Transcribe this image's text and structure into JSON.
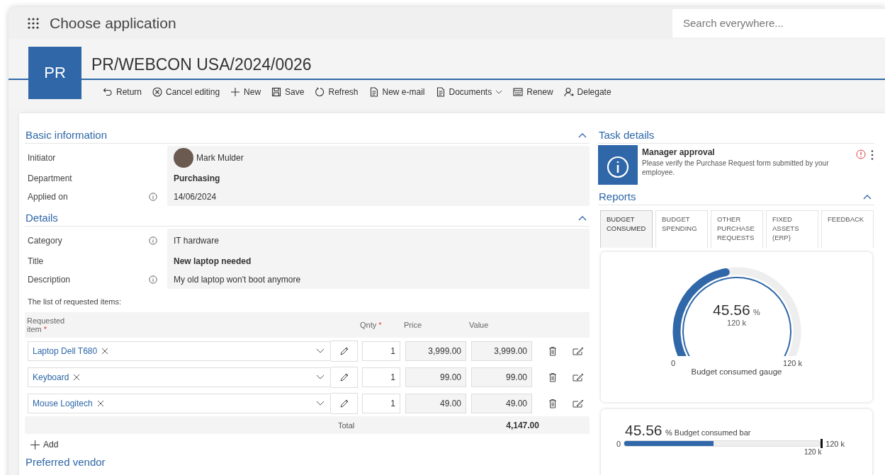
{
  "app_bar": {
    "title": "Choose application",
    "search": {
      "placeholder": "Search everywhere..."
    }
  },
  "document": {
    "tile": "PR",
    "title": "PR/WEBCON USA/2024/0026"
  },
  "toolbar": [
    {
      "label": "Return",
      "kind": "return",
      "dropdown": false
    },
    {
      "label": "Cancel editing",
      "kind": "cancel",
      "dropdown": false
    },
    {
      "label": "New",
      "kind": "new",
      "dropdown": false
    },
    {
      "label": "Save",
      "kind": "save",
      "dropdown": false
    },
    {
      "label": "Refresh",
      "kind": "refresh",
      "dropdown": false
    },
    {
      "label": "New e-mail",
      "kind": "document",
      "dropdown": false
    },
    {
      "label": "Documents",
      "kind": "document",
      "dropdown": true
    },
    {
      "label": "Renew",
      "kind": "renew",
      "dropdown": false
    },
    {
      "label": "Delegate",
      "kind": "delegate",
      "dropdown": false
    }
  ],
  "sections": [
    {
      "title": "Basic information",
      "expanded": true,
      "fields": [
        {
          "label": "Initiator",
          "info": false,
          "kind": "person",
          "value": "Mark Mulder"
        },
        {
          "label": "Department",
          "info": false,
          "kind": "bold",
          "value": "Purchasing"
        },
        {
          "label": "Applied on",
          "info": true,
          "kind": "text",
          "value": "14/06/2024"
        }
      ]
    },
    {
      "title": "Details",
      "expanded": true,
      "fields": [
        {
          "label": "Category",
          "info": true,
          "kind": "text",
          "value": "IT hardware"
        },
        {
          "label": "Title",
          "info": false,
          "kind": "bold",
          "value": "New laptop needed"
        },
        {
          "label": "Description",
          "info": true,
          "kind": "text",
          "value": "My old laptop won't boot anymore"
        }
      ]
    }
  ],
  "items_table": {
    "caption": "The list of requested items:",
    "columns": [
      {
        "label": "Requested item",
        "required_mark": "*"
      },
      {
        "label": "Qnty",
        "required_mark": "*"
      },
      {
        "label": "Price"
      },
      {
        "label": "Value"
      }
    ],
    "rows": [
      {
        "item": "Laptop Dell T680",
        "qty": "1",
        "price": "3,999.00",
        "value": "3,999.00"
      },
      {
        "item": "Keyboard",
        "qty": "1",
        "price": "99.00",
        "value": "99.00"
      },
      {
        "item": "Mouse Logitech",
        "qty": "1",
        "price": "49.00",
        "value": "49.00"
      }
    ],
    "total_label": "Total",
    "total": "4,147.00",
    "add_label": "Add"
  },
  "next_section": {
    "title": "Preferred vendor"
  },
  "task": {
    "title": "Task details",
    "name": "Manager approval",
    "description": "Please verify the Purchase Request form submitted by your employee."
  },
  "reports": {
    "title": "Reports",
    "expanded": true,
    "tabs": [
      {
        "label": "BUDGET CONSUMED",
        "selected": true
      },
      {
        "label": "BUDGET SPENDING",
        "selected": false
      },
      {
        "label": "OTHER PURCHASE REQUESTS",
        "selected": false
      },
      {
        "label": "FIXED ASSETS (ERP)",
        "selected": false
      },
      {
        "label": "FEEDBACK",
        "selected": false
      }
    ],
    "gauge": {
      "value": "45.56",
      "unit": "%",
      "sub": "120 k",
      "min": "0",
      "max": "120 k",
      "caption": "Budget consumed gauge",
      "level": 0.4556
    },
    "bar": {
      "value": "45.56",
      "unit": "%",
      "caption": "Budget consumed bar",
      "min": "0",
      "max": "120 k",
      "target": "120 k",
      "level": 0.4556
    }
  }
}
